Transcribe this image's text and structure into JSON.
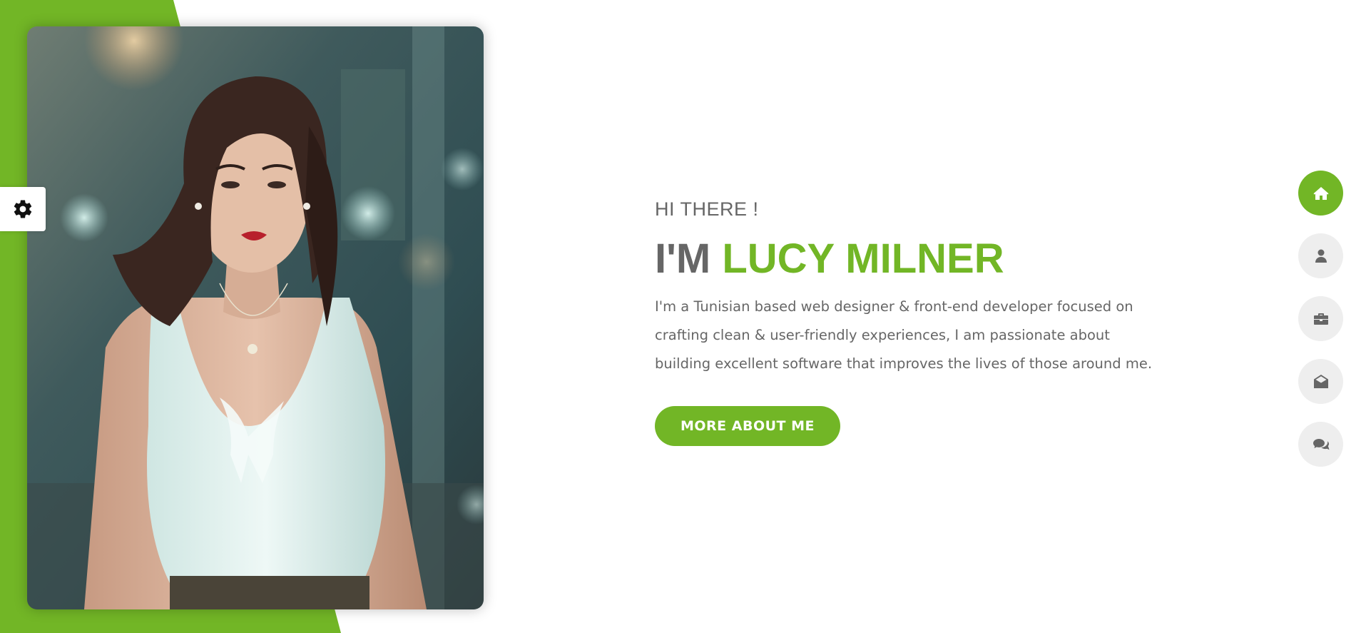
{
  "theme": {
    "accent": "#72b626",
    "text_muted": "#666666",
    "nav_inactive_bg": "#eeeeee",
    "nav_icon_color": "#666666"
  },
  "settings": {
    "icon": "gear-icon"
  },
  "portrait": {
    "alt": "Portrait photo"
  },
  "hero": {
    "greeting": "HI THERE !",
    "title_prefix": "I'M ",
    "title_name": "LUCY MILNER",
    "description": "I'm a Tunisian based web designer & front-end developer focused on crafting clean & user-friendly experiences, I am passionate about building excellent software that improves the lives of those around me.",
    "cta_label": "MORE ABOUT ME"
  },
  "nav": [
    {
      "icon": "home-icon",
      "active": true
    },
    {
      "icon": "user-icon",
      "active": false
    },
    {
      "icon": "briefcase-icon",
      "active": false
    },
    {
      "icon": "envelope-open-icon",
      "active": false
    },
    {
      "icon": "comments-icon",
      "active": false
    }
  ]
}
